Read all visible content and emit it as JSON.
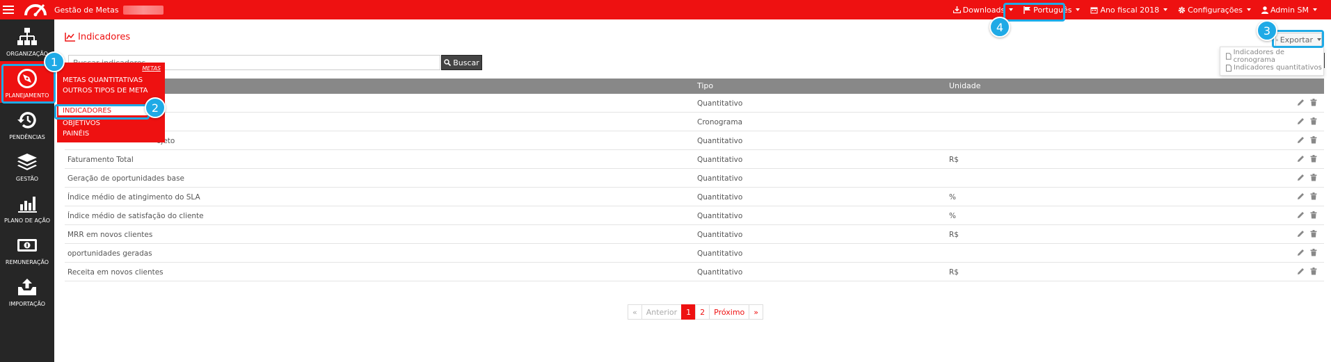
{
  "topbar": {
    "app_title": "Gestão de Metas",
    "nav": [
      {
        "label": "Downloads",
        "icon": "download-icon"
      },
      {
        "label": "Português",
        "icon": "flag-icon"
      },
      {
        "label": "Ano fiscal 2018",
        "icon": "calendar-icon"
      },
      {
        "label": "Configurações",
        "icon": "gear-icon"
      },
      {
        "label": "Admin SM",
        "icon": "user-icon"
      }
    ]
  },
  "sidebar": {
    "items": [
      {
        "label": "ORGANIZAÇÃO",
        "icon": "org-chart-icon"
      },
      {
        "label": "PLANEJAMENTO",
        "icon": "compass-icon"
      },
      {
        "label": "PENDÊNCIAS",
        "icon": "history-icon"
      },
      {
        "label": "GESTÃO",
        "icon": "layers-icon"
      },
      {
        "label": "PLANO DE AÇÃO",
        "icon": "bar-chart-icon"
      },
      {
        "label": "REMUNERAÇÃO",
        "icon": "money-icon"
      },
      {
        "label": "IMPORTAÇÃO",
        "icon": "upload-icon"
      }
    ]
  },
  "page": {
    "title": "Indicadores",
    "search_placeholder": "Buscar indicadores",
    "search_button": "Buscar",
    "export_button": "Exportar",
    "export_menu": [
      "Indicadores de cronograma",
      "Indicadores quantitativos"
    ]
  },
  "planning_menu": {
    "header": "METAS",
    "items": [
      "METAS QUANTITATIVAS",
      "OUTROS TIPOS DE META",
      "INDICADORES",
      "OBJETIVOS",
      "PAINÉIS"
    ],
    "selected_index": 2
  },
  "table": {
    "headers": {
      "tipo": "Tipo",
      "unidade": "Unidade"
    },
    "rows": [
      {
        "name": "",
        "tipo": "Quantitativo",
        "unidade": ""
      },
      {
        "name": "",
        "tipo": "Cronograma",
        "unidade": ""
      },
      {
        "name": "ojeto",
        "tipo": "Quantitativo",
        "unidade": ""
      },
      {
        "name": "Faturamento Total",
        "tipo": "Quantitativo",
        "unidade": "R$"
      },
      {
        "name": "Geração de oportunidades base",
        "tipo": "Quantitativo",
        "unidade": ""
      },
      {
        "name": "Índice médio de atingimento do SLA",
        "tipo": "Quantitativo",
        "unidade": "%"
      },
      {
        "name": "Índice médio de satisfação do cliente",
        "tipo": "Quantitativo",
        "unidade": "%"
      },
      {
        "name": "MRR em novos clientes",
        "tipo": "Quantitativo",
        "unidade": "R$"
      },
      {
        "name": "oportunidades geradas",
        "tipo": "Quantitativo",
        "unidade": ""
      },
      {
        "name": "Receita em novos clientes",
        "tipo": "Quantitativo",
        "unidade": "R$"
      }
    ]
  },
  "pagination": {
    "first": "«",
    "prev": "Anterior",
    "pages": [
      "1",
      "2"
    ],
    "current": "1",
    "next": "Próximo",
    "last": "»"
  },
  "callouts": [
    "1",
    "2",
    "3",
    "4"
  ],
  "colors": {
    "brand": "#ee1111",
    "sidebar": "#262626",
    "callout": "#1faae6"
  }
}
